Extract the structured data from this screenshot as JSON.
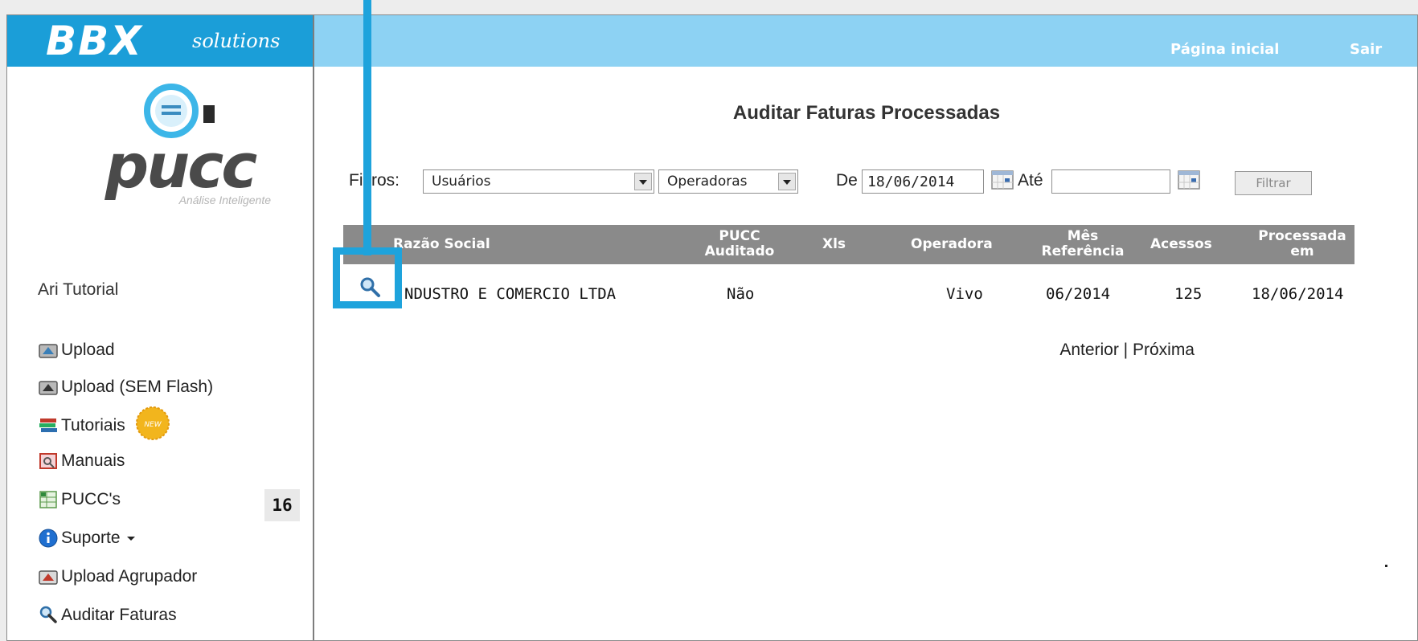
{
  "brand": {
    "name": "BBX",
    "suffix": "solutions"
  },
  "logo": {
    "wordmark": "pucc",
    "tagline": "Análise Inteligente"
  },
  "sidebar": {
    "user": "Ari Tutorial",
    "items": [
      {
        "label": "Upload",
        "icon": "upload-icon"
      },
      {
        "label": "Upload (SEM Flash)",
        "icon": "upload-icon"
      },
      {
        "label": "Tutoriais",
        "icon": "books-icon",
        "badge": "NEW"
      },
      {
        "label": "Manuais",
        "icon": "manual-icon"
      },
      {
        "label": "PUCC's",
        "icon": "spreadsheet-icon",
        "count": "16"
      },
      {
        "label": "Suporte",
        "icon": "info-icon"
      },
      {
        "label": "Upload Agrupador",
        "icon": "upload-red-icon"
      },
      {
        "label": "Auditar Faturas",
        "icon": "magnifier-icon"
      }
    ]
  },
  "header": {
    "home": "Página inicial",
    "logout": "Sair"
  },
  "page": {
    "title": "Auditar Faturas Processadas"
  },
  "filters": {
    "label": "Filtros:",
    "users_select": "Usuários",
    "operators_select": "Operadoras",
    "from_label": "De",
    "from_value": "18/06/2014",
    "to_label": "Até",
    "to_value": "",
    "filter_button": "Filtrar"
  },
  "table": {
    "headers": {
      "razao": "Razão Social",
      "auditado_1": "PUCC",
      "auditado_2": "Auditado",
      "xls": "Xls",
      "operadora": "Operadora",
      "mes_1": "Mês",
      "mes_2": "Referência",
      "acessos": "Acessos",
      "processada_1": "Processada",
      "processada_2": "em"
    },
    "rows": [
      {
        "razao": "NDUSTRO E COMERCIO LTDA",
        "auditado": "Não",
        "xls": "",
        "operadora": "Vivo",
        "mes": "06/2014",
        "acessos": "125",
        "processada": "18/06/2014"
      }
    ]
  },
  "pager": {
    "prev": "Anterior",
    "separator": " | ",
    "next": "Próxima"
  },
  "colors": {
    "brand_blue": "#1b9ed8",
    "header_light_blue": "#8dd2f3",
    "table_header_gray": "#8a8a8a",
    "annotation_blue": "#1ea3dc"
  }
}
